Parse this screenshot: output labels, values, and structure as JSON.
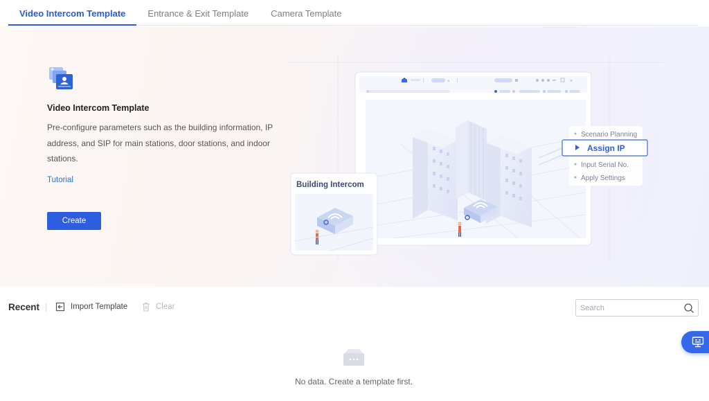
{
  "tabs": [
    {
      "label": "Video Intercom Template",
      "active": true
    },
    {
      "label": "Entrance & Exit Template",
      "active": false
    },
    {
      "label": "Camera Template",
      "active": false
    }
  ],
  "hero": {
    "title": "Video Intercom Template",
    "description": "Pre-configure parameters such as the building information, IP address, and SIP for main stations, door stations, and indoor stations.",
    "link": "Tutorial",
    "create_label": "Create",
    "icon": "video-intercom-template-icon"
  },
  "illustration": {
    "card_label": "Building Intercom",
    "steps": [
      "Scenario Planning",
      "Assign IP",
      "Input Serial No.",
      "Apply Settings"
    ],
    "active_step": "Assign IP"
  },
  "recent": {
    "title": "Recent",
    "import_label": "Import Template",
    "clear_label": "Clear",
    "search_placeholder": "Search",
    "empty_text": "No data. Create a template first."
  },
  "colors": {
    "accent": "#2e5ee0",
    "tab_active": "#2a5bd7",
    "link": "#2a72d8"
  }
}
